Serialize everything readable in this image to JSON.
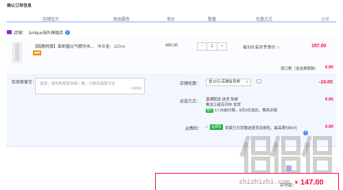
{
  "page": {
    "title": "确认订单信息"
  },
  "columns": {
    "shop_treasure": "店铺宝贝",
    "attributes": "商品属性",
    "unit_price": "单价",
    "quantity": "数量",
    "discount_method": "优惠方式",
    "subtotal": "小计"
  },
  "shop": {
    "label": "店铺：",
    "name": "Jurlique海外旗舰店",
    "info_icon": "info-icon",
    "icon_color": "#8a2be2"
  },
  "item": {
    "tag": "【临期特惠】",
    "title": "茱莉蔻元气精华水...",
    "spec_label": "净含量：",
    "spec_value": "150ml",
    "price": "490.00",
    "quantity": "1",
    "minus": "−",
    "plus": "+",
    "promo": "省333:会员专享价",
    "promo_arrow": "▽",
    "subtotal": "157.00"
  },
  "tax": {
    "label": "进口税（含运费税款）",
    "value": "0.00"
  },
  "message": {
    "label": "给卖家留言：",
    "placeholder": "选填，请先和商家协商一致，付款后商家可见",
    "count": "0/200"
  },
  "coupon": {
    "label": "店铺优惠：",
    "selected": "省10元:店铺会员券",
    "chevron": "∨",
    "value": "-10.00"
  },
  "shipping": {
    "label": "运送方式：",
    "line1": "普通配送 送货 免邮",
    "line2": "黑龙江绥芬河市 发货",
    "badge": "预计",
    "line3": "17:30前付款，8月2日送达，晚到必赔",
    "value": "0.00"
  },
  "insurance": {
    "label": "运费险：",
    "check": "✓",
    "tag": "运费险",
    "text": "卖家已为您赠送退货运费险，最高限付80元",
    "info_icon": "info-icon",
    "value": "0.00"
  },
  "summary": {
    "paid_label": "实付款：",
    "currency": "¥",
    "paid_value": "147.00"
  },
  "watermark": {
    "url": "zhizhizhi.com"
  },
  "colors": {
    "accent_red": "#ff0036",
    "header_line": "#b2d1ff",
    "detail_bg": "#f2f7ff"
  }
}
